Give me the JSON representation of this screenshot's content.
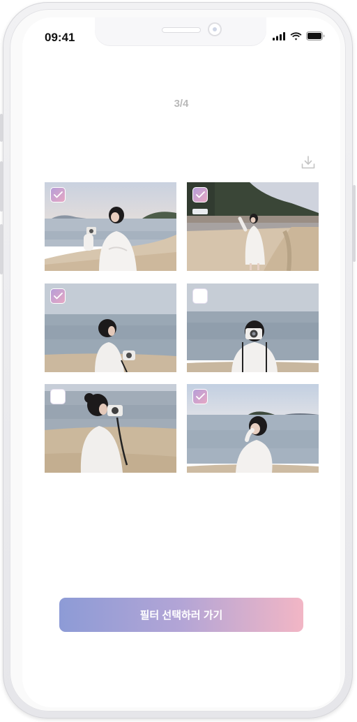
{
  "status_bar": {
    "time": "09:41",
    "icons": [
      "cellular-signal-icon",
      "wifi-icon",
      "battery-icon"
    ]
  },
  "header": {
    "page_counter": "3/4"
  },
  "toolbar": {
    "download_icon": "download-icon"
  },
  "photos": [
    {
      "selected": true,
      "scene": "beach-camera-smile"
    },
    {
      "selected": true,
      "scene": "beach-pine-trees-standing"
    },
    {
      "selected": true,
      "scene": "sea-side-profile-camera"
    },
    {
      "selected": false,
      "scene": "sea-front-camera"
    },
    {
      "selected": false,
      "scene": "beach-camera-side"
    },
    {
      "selected": true,
      "scene": "sea-island-covering-face"
    }
  ],
  "cta": {
    "label": "필터 선택하러 가기"
  },
  "colors": {
    "accent_start": "#8d9bd6",
    "accent_end": "#f2b6c5",
    "check_gradient_start": "#b69ed8",
    "check_gradient_end": "#e6a7c3",
    "counter_text": "#b9b9b9"
  }
}
